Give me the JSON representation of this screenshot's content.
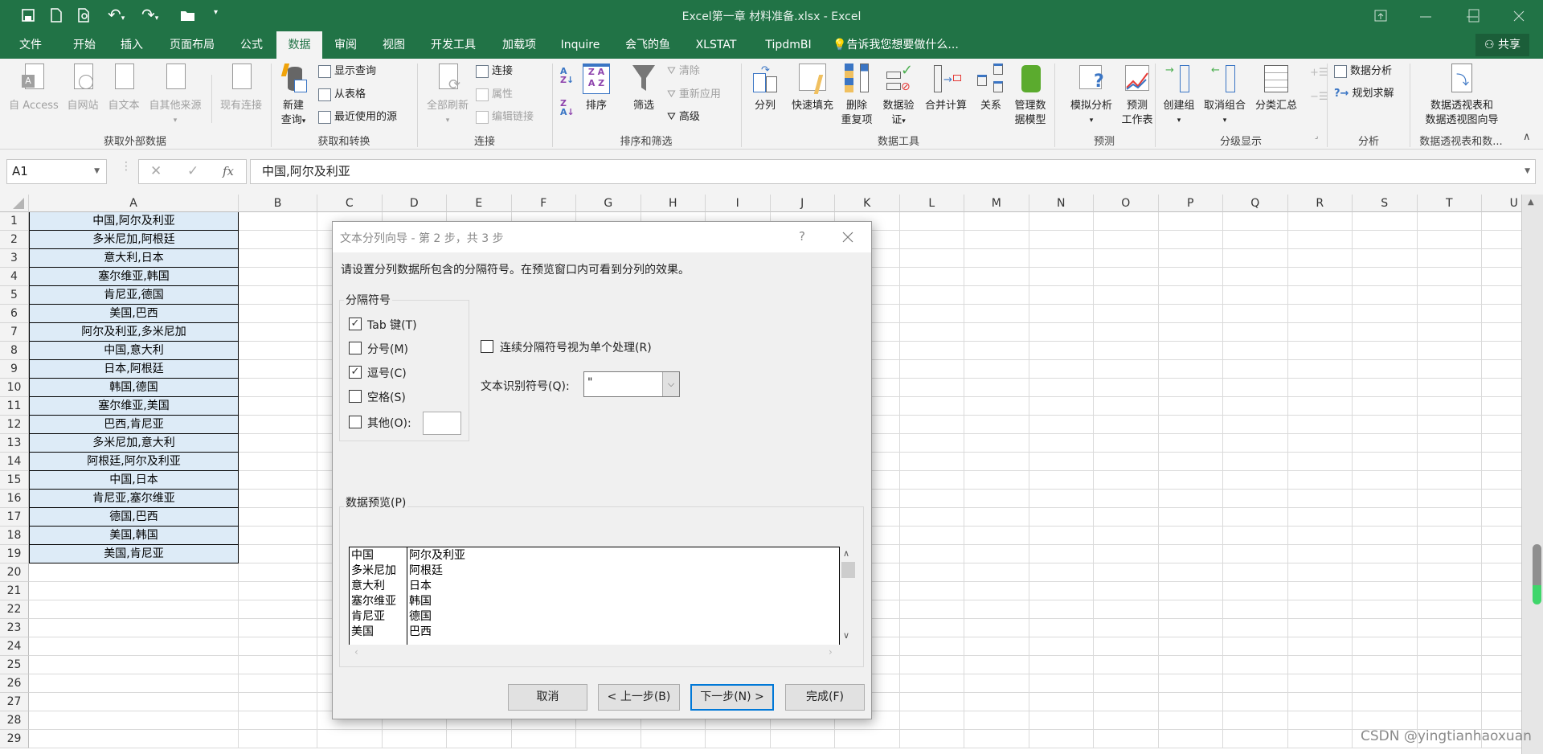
{
  "colors": {
    "brand": "#217346",
    "selected_fill": "#ddebf7",
    "default_button_border": "#0078d7"
  },
  "title_bar": {
    "title": "Excel第一章 材料准备.xlsx - Excel",
    "quick_access": [
      "save-icon",
      "new-file-icon",
      "print-preview-icon",
      "undo-icon",
      "redo-icon",
      "open-folder-icon",
      "customize-icon"
    ]
  },
  "tabs": [
    {
      "label": "文件"
    },
    {
      "label": "开始"
    },
    {
      "label": "插入"
    },
    {
      "label": "页面布局"
    },
    {
      "label": "公式"
    },
    {
      "label": "数据",
      "active": true
    },
    {
      "label": "审阅"
    },
    {
      "label": "视图"
    },
    {
      "label": "开发工具"
    },
    {
      "label": "加载项"
    },
    {
      "label": "Inquire"
    },
    {
      "label": "会飞的鱼"
    },
    {
      "label": "XLSTAT"
    },
    {
      "label": "TipdmBI"
    }
  ],
  "tell_me": "告诉我您想要做什么...",
  "share": "共享",
  "ribbon": {
    "groups": [
      "获取外部数据",
      "获取和转换",
      "连接",
      "排序和筛选",
      "数据工具",
      "预测",
      "分级显示",
      "分析",
      "数据透视表和数..."
    ],
    "external": [
      "自 Access",
      "自网站",
      "自文本",
      "自其他来源",
      "现有连接"
    ],
    "new_query": [
      "新建",
      "查询"
    ],
    "transform": [
      "显示查询",
      "从表格",
      "最近使用的源"
    ],
    "refresh_all": "全部刷新",
    "connections": [
      "连接",
      "属性",
      "编辑链接"
    ],
    "sort": "排序",
    "filter": "筛选",
    "filter_small": [
      "清除",
      "重新应用",
      "高级"
    ],
    "data_tools": {
      "text_to_columns": "分列",
      "flash_fill": "快速填充",
      "remove_dup": [
        "删除",
        "重复项"
      ],
      "validation": [
        "数据验",
        "证"
      ],
      "consolidate": "合并计算",
      "relationships": "关系",
      "data_model": [
        "管理数",
        "据模型"
      ]
    },
    "forecast": {
      "what_if": "模拟分析",
      "sheet": [
        "预测",
        "工作表"
      ]
    },
    "outline": {
      "group": "创建组",
      "ungroup": "取消组合",
      "subtotal": "分类汇总"
    },
    "analysis": [
      "数据分析",
      "规划求解"
    ],
    "pivot": [
      "数据透视表和",
      "数据透视图向导"
    ]
  },
  "formula_bar": {
    "name_box": "A1",
    "fx": "fx",
    "formula": "中国,阿尔及利亚"
  },
  "sheet": {
    "columns": [
      "A",
      "B",
      "C",
      "D",
      "E",
      "F",
      "G",
      "H",
      "I",
      "J",
      "K",
      "L",
      "M",
      "N",
      "O",
      "P",
      "Q",
      "R",
      "S",
      "T",
      "U"
    ],
    "row_count": 29,
    "col_a": [
      "中国,阿尔及利亚",
      "多米尼加,阿根廷",
      "意大利,日本",
      "塞尔维亚,韩国",
      "肯尼亚,德国",
      "美国,巴西",
      "阿尔及利亚,多米尼加",
      "中国,意大利",
      "日本,阿根廷",
      "韩国,德国",
      "塞尔维亚,美国",
      "巴西,肯尼亚",
      "多米尼加,意大利",
      "阿根廷,阿尔及利亚",
      "中国,日本",
      "肯尼亚,塞尔维亚",
      "德国,巴西",
      "美国,韩国",
      "美国,肯尼亚"
    ]
  },
  "dialog": {
    "title": "文本分列向导 - 第 2 步，共 3 步",
    "help": "?",
    "instruction": "请设置分列数据所包含的分隔符号。在预览窗口内可看到分列的效果。",
    "delimiters_label": "分隔符号",
    "delimiters": [
      {
        "label": "Tab 键(T)",
        "checked": true
      },
      {
        "label": "分号(M)",
        "checked": false
      },
      {
        "label": "逗号(C)",
        "checked": true
      },
      {
        "label": "空格(S)",
        "checked": false
      },
      {
        "label": "其他(O):",
        "checked": false
      }
    ],
    "other_value": "",
    "consecutive": {
      "label": "连续分隔符号视为单个处理(R)",
      "checked": false
    },
    "qualifier_label": "文本识别符号(Q):",
    "qualifier_value": "\"",
    "preview_label": "数据预览(P)",
    "preview": [
      [
        "中国",
        "阿尔及利亚"
      ],
      [
        "多米尼加",
        "阿根廷"
      ],
      [
        "意大利",
        "日本"
      ],
      [
        "塞尔维亚",
        "韩国"
      ],
      [
        "肯尼亚",
        "德国"
      ],
      [
        "美国",
        "巴西"
      ]
    ],
    "buttons": {
      "cancel": "取消",
      "back": "< 上一步(B)",
      "next": "下一步(N) >",
      "finish": "完成(F)"
    }
  },
  "watermark": "CSDN @yingtianhaoxuan"
}
